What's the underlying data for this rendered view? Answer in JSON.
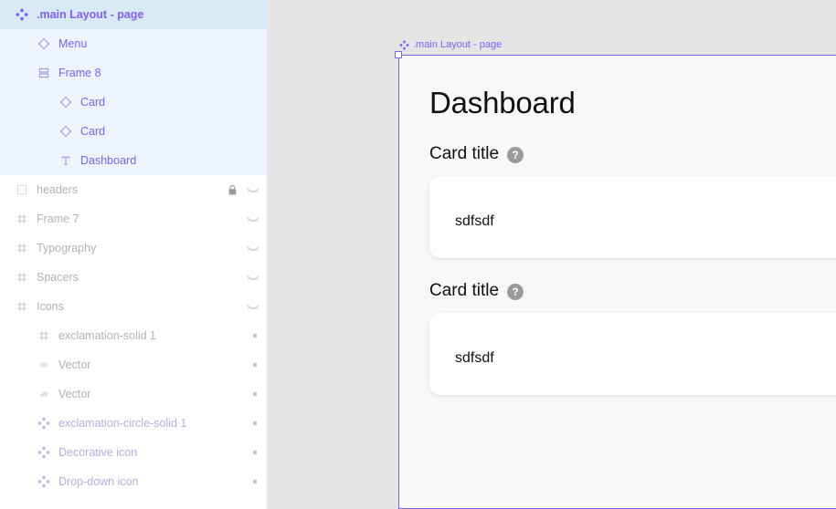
{
  "sidebar": {
    "rows": [
      {
        "label": ".main Layout - page",
        "icon": "component-icon",
        "depth": 0,
        "state": "selected-head",
        "lock": false,
        "hidden_eye": false,
        "dot": false
      },
      {
        "label": "Menu",
        "icon": "instance-diamond-icon",
        "depth": 1,
        "state": "selected-child",
        "lock": false,
        "hidden_eye": false,
        "dot": false
      },
      {
        "label": "Frame 8",
        "icon": "auto-layout-icon",
        "depth": 1,
        "state": "selected-child",
        "lock": false,
        "hidden_eye": false,
        "dot": false
      },
      {
        "label": "Card",
        "icon": "instance-diamond-icon",
        "depth": 2,
        "state": "selected-child",
        "lock": false,
        "hidden_eye": false,
        "dot": false
      },
      {
        "label": "Card",
        "icon": "instance-diamond-icon",
        "depth": 2,
        "state": "selected-child",
        "lock": false,
        "hidden_eye": false,
        "dot": false
      },
      {
        "label": "Dashboard",
        "icon": "text-layer-icon",
        "depth": 2,
        "state": "selected-child",
        "lock": false,
        "hidden_eye": false,
        "dot": false
      },
      {
        "label": "headers",
        "icon": "section-icon",
        "depth": 0,
        "state": "dimmed",
        "lock": true,
        "hidden_eye": true,
        "dot": false
      },
      {
        "label": "Frame 7",
        "icon": "frame-hash-icon",
        "depth": 0,
        "state": "dimmed",
        "lock": false,
        "hidden_eye": true,
        "dot": false
      },
      {
        "label": "Typography",
        "icon": "frame-hash-icon",
        "depth": 0,
        "state": "dimmed",
        "lock": false,
        "hidden_eye": true,
        "dot": false
      },
      {
        "label": "Spacers",
        "icon": "frame-hash-icon",
        "depth": 0,
        "state": "dimmed",
        "lock": false,
        "hidden_eye": true,
        "dot": false
      },
      {
        "label": "Icons",
        "icon": "frame-hash-icon",
        "depth": 0,
        "state": "dimmed",
        "lock": false,
        "hidden_eye": true,
        "dot": false
      },
      {
        "label": "exclamation-solid 1",
        "icon": "frame-hash-icon",
        "depth": 1,
        "state": "dimmed",
        "lock": false,
        "hidden_eye": false,
        "dot": true
      },
      {
        "label": "Vector",
        "icon": "vector-eye-icon",
        "depth": 1,
        "state": "dimmed",
        "lock": false,
        "hidden_eye": false,
        "dot": true
      },
      {
        "label": "Vector",
        "icon": "vector-shape-icon",
        "depth": 1,
        "state": "dimmed",
        "lock": false,
        "hidden_eye": false,
        "dot": true
      },
      {
        "label": "exclamation-circle-solid 1",
        "icon": "component-icon",
        "depth": 1,
        "state": "dimmed-purple",
        "lock": false,
        "hidden_eye": false,
        "dot": true
      },
      {
        "label": "Decorative icon",
        "icon": "component-icon",
        "depth": 1,
        "state": "dimmed-purple",
        "lock": false,
        "hidden_eye": false,
        "dot": true
      },
      {
        "label": "Drop-down icon",
        "icon": "component-icon",
        "depth": 1,
        "state": "dimmed-purple",
        "lock": false,
        "hidden_eye": false,
        "dot": true
      }
    ]
  },
  "canvas": {
    "frame_label": ".main Layout - page",
    "frame_label_icon": "component-icon",
    "page": {
      "title": "Dashboard",
      "cards": [
        {
          "title": "Card title",
          "help_icon": "question-mark-icon",
          "body": "sdfsdf"
        },
        {
          "title": "Card title",
          "help_icon": "question-mark-icon",
          "body": "sdfsdf"
        }
      ]
    }
  },
  "colors": {
    "selection_purple": "#7b61ff",
    "selected_row_head": "#d9eaf7",
    "selected_row_child": "#eef4fb",
    "canvas_background": "#e5e5e5",
    "page_background": "#f8f8f8",
    "card_background": "#ffffff",
    "help_icon_background": "#9b9b9b"
  }
}
